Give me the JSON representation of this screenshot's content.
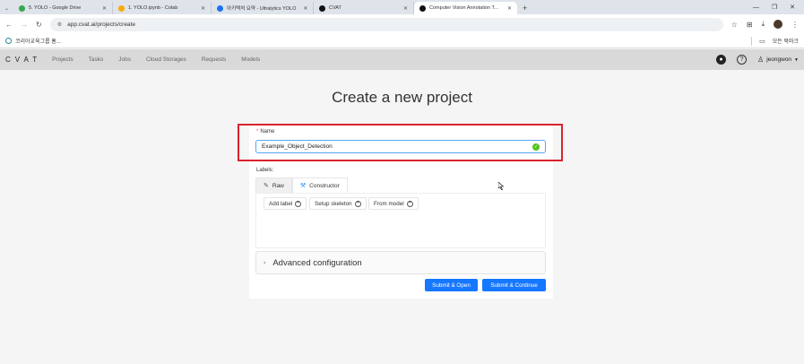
{
  "browser": {
    "tabs": [
      {
        "label": "5. YOLO - Google Drive",
        "color": "#34a853"
      },
      {
        "label": "1. YOLO.ipynb - Colab",
        "color": "#f9ab00"
      },
      {
        "label": "아키텍처 요약 - Ultralytics YOLO",
        "color": "#1a73e8"
      },
      {
        "label": "CVAT",
        "color": "#111111"
      },
      {
        "label": "Computer Vision Annotation T...",
        "color": "#111111",
        "active": true
      }
    ],
    "new_tab": "+",
    "url": "app.cvat.ai/projects/create",
    "bookmark_left": "코리아교육그룹 홈...",
    "bookmark_right": "모든 북마크"
  },
  "cvat": {
    "logo": "CVAT",
    "nav": [
      "Projects",
      "Tasks",
      "Jobs",
      "Cloud Storages",
      "Requests",
      "Models"
    ],
    "username": "jeongwon"
  },
  "form": {
    "title": "Create a new project",
    "name_label": "Name",
    "name_value": "Example_Object_Detection",
    "labels_label": "Labels:",
    "tab_raw": "Raw",
    "tab_constructor": "Constructor",
    "add_label": "Add label",
    "setup_skeleton": "Setup skeleton",
    "from_model": "From model",
    "advanced": "Advanced configuration",
    "submit_open": "Submit & Open",
    "submit_continue": "Submit & Continue"
  },
  "colors": {
    "primary": "#1677ff",
    "highlight": "#d9232e",
    "success": "#52c41a"
  }
}
